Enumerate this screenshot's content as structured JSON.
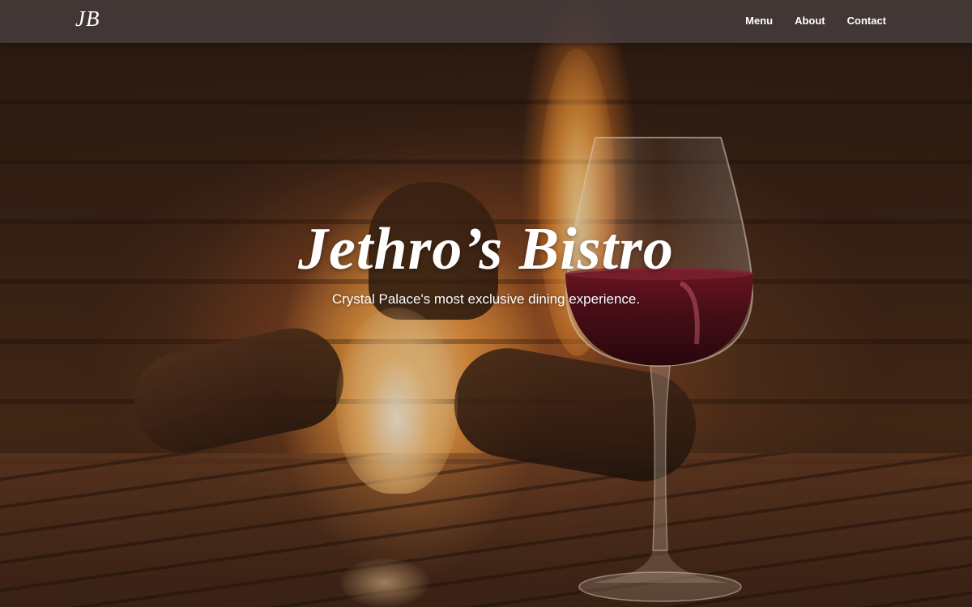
{
  "navbar": {
    "logo": "JB",
    "links": [
      {
        "label": "Menu"
      },
      {
        "label": "About"
      },
      {
        "label": "Contact"
      }
    ]
  },
  "hero": {
    "title": "Jethro’s Bistro",
    "subtitle": "Crystal Palace's most exclusive dining experience."
  },
  "colors": {
    "navbar_bg": "#483e3e",
    "text": "#ffffff",
    "wine": "#5a0f1e"
  }
}
